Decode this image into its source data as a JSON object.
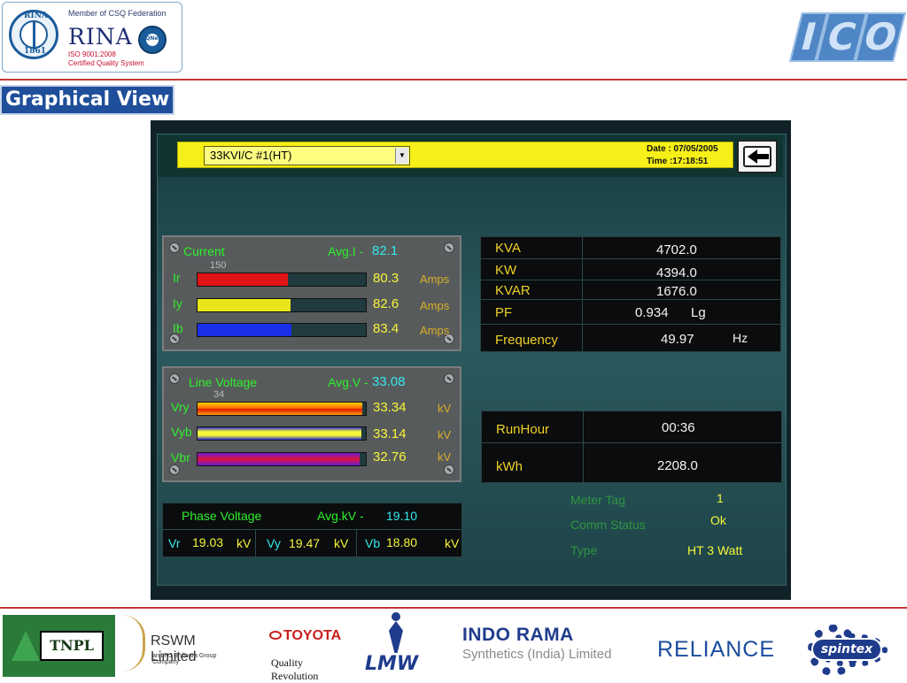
{
  "header": {
    "rina": {
      "member_text": "Member of CSQ Federation",
      "name": "RINA",
      "iso": "ISO 9001:2008",
      "certified": "Certified Quality System",
      "seal_text": "RINA",
      "seal_year": "1861",
      "inet_text": "IQNet"
    },
    "ico_logo": "ICO"
  },
  "section_title": "Graphical View",
  "app": {
    "meter_select": {
      "value": "33KVI/C #1(HT)"
    },
    "date": "Date : 07/05/2005",
    "time": "Time :17:18:51",
    "back_icon": "arrow-left-icon"
  },
  "current": {
    "title": "Current",
    "avg_label": "Avg.I -",
    "avg_value": "82.1",
    "scale": "150",
    "unit": "Amps",
    "phases": [
      {
        "label": "Ir",
        "value": "80.3",
        "fraction": 0.535,
        "color": "#e01414"
      },
      {
        "label": "Iy",
        "value": "82.6",
        "fraction": 0.551,
        "color": "#e9e51a"
      },
      {
        "label": "Ib",
        "value": "83.4",
        "fraction": 0.556,
        "color": "#1a2fe6"
      }
    ]
  },
  "line_voltage": {
    "title": "Line Voltage",
    "avg_label": "Avg.V -",
    "avg_value": "33.08",
    "scale": "34",
    "unit": "kV",
    "phases": [
      {
        "label": "Vry",
        "value": "33.34",
        "fraction": 0.98,
        "style": "orange-gradient"
      },
      {
        "label": "Vyb",
        "value": "33.14",
        "fraction": 0.975,
        "style": "yellow-blue-gradient"
      },
      {
        "label": "Vbr",
        "value": "32.76",
        "fraction": 0.964,
        "style": "purple-red-gradient"
      }
    ]
  },
  "power": {
    "rows": [
      {
        "label": "KVA",
        "value": "4702.0",
        "unit": ""
      },
      {
        "label": "KW",
        "value": "4394.0",
        "unit": ""
      },
      {
        "label": "KVAR",
        "value": "1676.0",
        "unit": ""
      },
      {
        "label": "PF",
        "value": "0.934",
        "unit": "Lg"
      },
      {
        "label": "Frequency",
        "value": "49.97",
        "unit": "Hz"
      }
    ]
  },
  "energy": {
    "rows": [
      {
        "label": "RunHour",
        "value": "00:36"
      },
      {
        "label": "kWh",
        "value": "2208.0"
      }
    ]
  },
  "phase_voltage": {
    "title": "Phase Voltage",
    "avg_label": "Avg.kV -",
    "avg_value": "19.10",
    "cells": [
      {
        "label": "Vr",
        "value": "19.03",
        "unit": "kV"
      },
      {
        "label": "Vy",
        "value": "19.47",
        "unit": "kV"
      },
      {
        "label": "Vb",
        "value": "18.80",
        "unit": "kV"
      }
    ]
  },
  "meter_info": {
    "rows": [
      {
        "label": "Meter Tag",
        "value": "1"
      },
      {
        "label": "Comm Status",
        "value": "Ok"
      },
      {
        "label": "Type",
        "value": "HT 3 Watt"
      }
    ]
  },
  "footer": {
    "tnpl": "TNPL",
    "rswm": "RSWM Limited",
    "rswm_sub": "an LNJ Bhilwara Group Company",
    "toyota": "TOYOTA",
    "toyota_sub": "Quality Revolution",
    "lmw": "LMW",
    "indorama": "INDO RAMA",
    "indorama_sub": "Synthetics (India) Limited",
    "reliance": "RELIANCE",
    "spintex": "spintex"
  }
}
